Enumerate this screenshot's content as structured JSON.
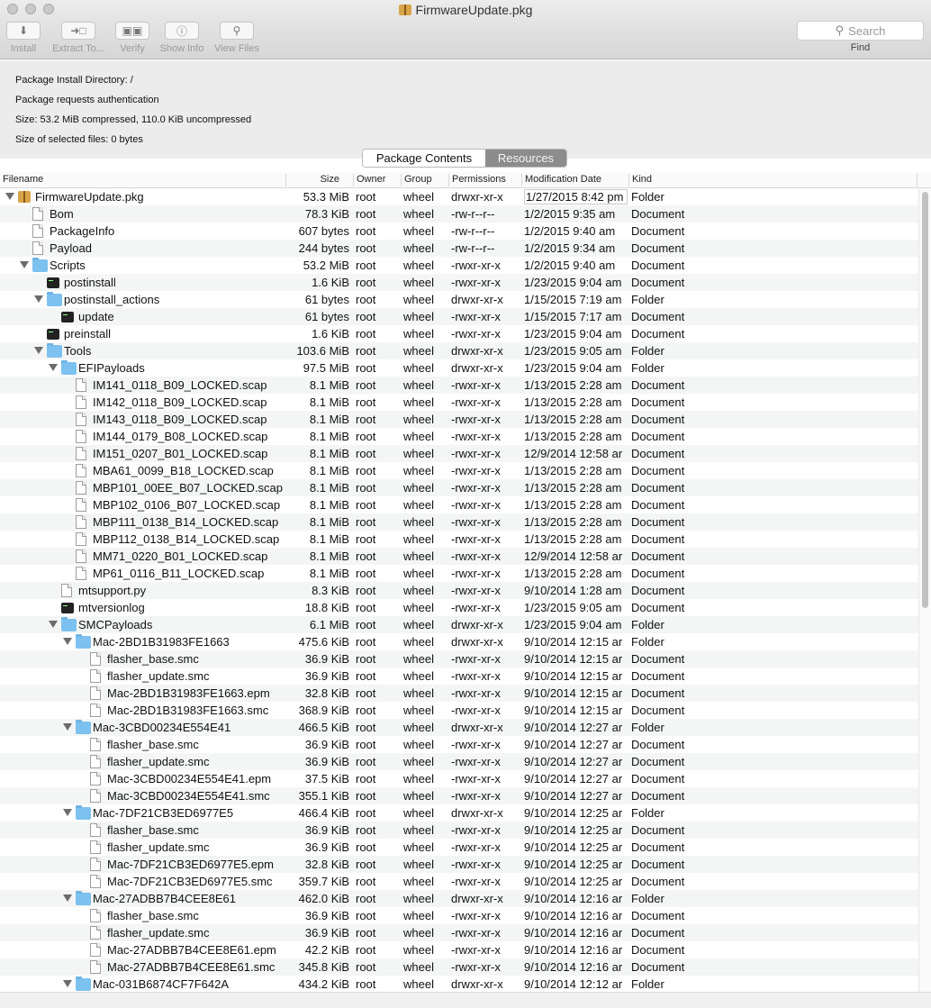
{
  "window": {
    "title": "FirmwareUpdate.pkg"
  },
  "toolbar": {
    "buttons": [
      {
        "label": "Install",
        "icon": "download-arrow-icon"
      },
      {
        "label": "Extract To...",
        "icon": "extract-folder-icon"
      },
      {
        "label": "Verify",
        "icon": "verify-documents-icon"
      },
      {
        "label": "Show Info",
        "icon": "info-icon"
      },
      {
        "label": "View Files",
        "icon": "magnifier-icon"
      }
    ],
    "search_placeholder": "Search",
    "find_label": "Find"
  },
  "info": {
    "install_dir": "Package Install Directory: /",
    "auth": "Package requests authentication",
    "size": "Size: 53.2 MiB compressed, 110.0 KiB uncompressed",
    "selected": "Size of selected files: 0 bytes"
  },
  "segmented": {
    "contents": "Package Contents",
    "resources": "Resources",
    "selected": "Package Contents"
  },
  "columns": [
    "Filename",
    "Size",
    "Owner",
    "Group",
    "Permissions",
    "Modification Date",
    "Kind"
  ],
  "rows": [
    {
      "d": 0,
      "t": "o",
      "i": "pkg",
      "n": "FirmwareUpdate.pkg",
      "s": "53.3 MiB",
      "o": "root",
      "g": "wheel",
      "p": "drwxr-xr-x",
      "m": "1/27/2015 8:42 pm",
      "k": "Folder"
    },
    {
      "d": 1,
      "t": "",
      "i": "doc",
      "n": "Bom",
      "s": "78.3 KiB",
      "o": "root",
      "g": "wheel",
      "p": "-rw-r--r--",
      "m": "1/2/2015 9:35 am",
      "k": "Document"
    },
    {
      "d": 1,
      "t": "",
      "i": "doc",
      "n": "PackageInfo",
      "s": "607 bytes",
      "o": "root",
      "g": "wheel",
      "p": "-rw-r--r--",
      "m": "1/2/2015 9:40 am",
      "k": "Document"
    },
    {
      "d": 1,
      "t": "",
      "i": "doc",
      "n": "Payload",
      "s": "244 bytes",
      "o": "root",
      "g": "wheel",
      "p": "-rw-r--r--",
      "m": "1/2/2015 9:34 am",
      "k": "Document"
    },
    {
      "d": 1,
      "t": "o",
      "i": "folder",
      "n": "Scripts",
      "s": "53.2 MiB",
      "o": "root",
      "g": "wheel",
      "p": "-rwxr-xr-x",
      "m": "1/2/2015 9:40 am",
      "k": "Document"
    },
    {
      "d": 2,
      "t": "",
      "i": "exec",
      "n": "postinstall",
      "s": "1.6 KiB",
      "o": "root",
      "g": "wheel",
      "p": "-rwxr-xr-x",
      "m": "1/23/2015 9:04 am",
      "k": "Document"
    },
    {
      "d": 2,
      "t": "o",
      "i": "folder",
      "n": "postinstall_actions",
      "s": "61 bytes",
      "o": "root",
      "g": "wheel",
      "p": "drwxr-xr-x",
      "m": "1/15/2015 7:19 am",
      "k": "Folder"
    },
    {
      "d": 3,
      "t": "",
      "i": "exec",
      "n": "update",
      "s": "61 bytes",
      "o": "root",
      "g": "wheel",
      "p": "-rwxr-xr-x",
      "m": "1/15/2015 7:17 am",
      "k": "Document"
    },
    {
      "d": 2,
      "t": "",
      "i": "exec",
      "n": "preinstall",
      "s": "1.6 KiB",
      "o": "root",
      "g": "wheel",
      "p": "-rwxr-xr-x",
      "m": "1/23/2015 9:04 am",
      "k": "Document"
    },
    {
      "d": 2,
      "t": "o",
      "i": "folder",
      "n": "Tools",
      "s": "103.6 MiB",
      "o": "root",
      "g": "wheel",
      "p": "drwxr-xr-x",
      "m": "1/23/2015 9:05 am",
      "k": "Folder"
    },
    {
      "d": 3,
      "t": "o",
      "i": "folder",
      "n": "EFIPayloads",
      "s": "97.5 MiB",
      "o": "root",
      "g": "wheel",
      "p": "drwxr-xr-x",
      "m": "1/23/2015 9:04 am",
      "k": "Folder"
    },
    {
      "d": 4,
      "t": "",
      "i": "doc",
      "n": "IM141_0118_B09_LOCKED.scap",
      "s": "8.1 MiB",
      "o": "root",
      "g": "wheel",
      "p": "-rwxr-xr-x",
      "m": "1/13/2015 2:28 am",
      "k": "Document"
    },
    {
      "d": 4,
      "t": "",
      "i": "doc",
      "n": "IM142_0118_B09_LOCKED.scap",
      "s": "8.1 MiB",
      "o": "root",
      "g": "wheel",
      "p": "-rwxr-xr-x",
      "m": "1/13/2015 2:28 am",
      "k": "Document"
    },
    {
      "d": 4,
      "t": "",
      "i": "doc",
      "n": "IM143_0118_B09_LOCKED.scap",
      "s": "8.1 MiB",
      "o": "root",
      "g": "wheel",
      "p": "-rwxr-xr-x",
      "m": "1/13/2015 2:28 am",
      "k": "Document"
    },
    {
      "d": 4,
      "t": "",
      "i": "doc",
      "n": "IM144_0179_B08_LOCKED.scap",
      "s": "8.1 MiB",
      "o": "root",
      "g": "wheel",
      "p": "-rwxr-xr-x",
      "m": "1/13/2015 2:28 am",
      "k": "Document"
    },
    {
      "d": 4,
      "t": "",
      "i": "doc",
      "n": "IM151_0207_B01_LOCKED.scap",
      "s": "8.1 MiB",
      "o": "root",
      "g": "wheel",
      "p": "-rwxr-xr-x",
      "m": "12/9/2014 12:58 ar",
      "k": "Document"
    },
    {
      "d": 4,
      "t": "",
      "i": "doc",
      "n": "MBA61_0099_B18_LOCKED.scap",
      "s": "8.1 MiB",
      "o": "root",
      "g": "wheel",
      "p": "-rwxr-xr-x",
      "m": "1/13/2015 2:28 am",
      "k": "Document"
    },
    {
      "d": 4,
      "t": "",
      "i": "doc",
      "n": "MBP101_00EE_B07_LOCKED.scap",
      "s": "8.1 MiB",
      "o": "root",
      "g": "wheel",
      "p": "-rwxr-xr-x",
      "m": "1/13/2015 2:28 am",
      "k": "Document"
    },
    {
      "d": 4,
      "t": "",
      "i": "doc",
      "n": "MBP102_0106_B07_LOCKED.scap",
      "s": "8.1 MiB",
      "o": "root",
      "g": "wheel",
      "p": "-rwxr-xr-x",
      "m": "1/13/2015 2:28 am",
      "k": "Document"
    },
    {
      "d": 4,
      "t": "",
      "i": "doc",
      "n": "MBP111_0138_B14_LOCKED.scap",
      "s": "8.1 MiB",
      "o": "root",
      "g": "wheel",
      "p": "-rwxr-xr-x",
      "m": "1/13/2015 2:28 am",
      "k": "Document"
    },
    {
      "d": 4,
      "t": "",
      "i": "doc",
      "n": "MBP112_0138_B14_LOCKED.scap",
      "s": "8.1 MiB",
      "o": "root",
      "g": "wheel",
      "p": "-rwxr-xr-x",
      "m": "1/13/2015 2:28 am",
      "k": "Document"
    },
    {
      "d": 4,
      "t": "",
      "i": "doc",
      "n": "MM71_0220_B01_LOCKED.scap",
      "s": "8.1 MiB",
      "o": "root",
      "g": "wheel",
      "p": "-rwxr-xr-x",
      "m": "12/9/2014 12:58 ar",
      "k": "Document"
    },
    {
      "d": 4,
      "t": "",
      "i": "doc",
      "n": "MP61_0116_B11_LOCKED.scap",
      "s": "8.1 MiB",
      "o": "root",
      "g": "wheel",
      "p": "-rwxr-xr-x",
      "m": "1/13/2015 2:28 am",
      "k": "Document"
    },
    {
      "d": 3,
      "t": "",
      "i": "doc",
      "n": "mtsupport.py",
      "s": "8.3 KiB",
      "o": "root",
      "g": "wheel",
      "p": "-rwxr-xr-x",
      "m": "9/10/2014 1:28 am",
      "k": "Document"
    },
    {
      "d": 3,
      "t": "",
      "i": "exec",
      "n": "mtversionlog",
      "s": "18.8 KiB",
      "o": "root",
      "g": "wheel",
      "p": "-rwxr-xr-x",
      "m": "1/23/2015 9:05 am",
      "k": "Document"
    },
    {
      "d": 3,
      "t": "o",
      "i": "folder",
      "n": "SMCPayloads",
      "s": "6.1 MiB",
      "o": "root",
      "g": "wheel",
      "p": "drwxr-xr-x",
      "m": "1/23/2015 9:04 am",
      "k": "Folder"
    },
    {
      "d": 4,
      "t": "o",
      "i": "folder",
      "n": "Mac-2BD1B31983FE1663",
      "s": "475.6 KiB",
      "o": "root",
      "g": "wheel",
      "p": "drwxr-xr-x",
      "m": "9/10/2014 12:15 ar",
      "k": "Folder"
    },
    {
      "d": 5,
      "t": "",
      "i": "doc",
      "n": "flasher_base.smc",
      "s": "36.9 KiB",
      "o": "root",
      "g": "wheel",
      "p": "-rwxr-xr-x",
      "m": "9/10/2014 12:15 ar",
      "k": "Document"
    },
    {
      "d": 5,
      "t": "",
      "i": "doc",
      "n": "flasher_update.smc",
      "s": "36.9 KiB",
      "o": "root",
      "g": "wheel",
      "p": "-rwxr-xr-x",
      "m": "9/10/2014 12:15 ar",
      "k": "Document"
    },
    {
      "d": 5,
      "t": "",
      "i": "doc",
      "n": "Mac-2BD1B31983FE1663.epm",
      "s": "32.8 KiB",
      "o": "root",
      "g": "wheel",
      "p": "-rwxr-xr-x",
      "m": "9/10/2014 12:15 ar",
      "k": "Document"
    },
    {
      "d": 5,
      "t": "",
      "i": "doc",
      "n": "Mac-2BD1B31983FE1663.smc",
      "s": "368.9 KiB",
      "o": "root",
      "g": "wheel",
      "p": "-rwxr-xr-x",
      "m": "9/10/2014 12:15 ar",
      "k": "Document"
    },
    {
      "d": 4,
      "t": "o",
      "i": "folder",
      "n": "Mac-3CBD00234E554E41",
      "s": "466.5 KiB",
      "o": "root",
      "g": "wheel",
      "p": "drwxr-xr-x",
      "m": "9/10/2014 12:27 ar",
      "k": "Folder"
    },
    {
      "d": 5,
      "t": "",
      "i": "doc",
      "n": "flasher_base.smc",
      "s": "36.9 KiB",
      "o": "root",
      "g": "wheel",
      "p": "-rwxr-xr-x",
      "m": "9/10/2014 12:27 ar",
      "k": "Document"
    },
    {
      "d": 5,
      "t": "",
      "i": "doc",
      "n": "flasher_update.smc",
      "s": "36.9 KiB",
      "o": "root",
      "g": "wheel",
      "p": "-rwxr-xr-x",
      "m": "9/10/2014 12:27 ar",
      "k": "Document"
    },
    {
      "d": 5,
      "t": "",
      "i": "doc",
      "n": "Mac-3CBD00234E554E41.epm",
      "s": "37.5 KiB",
      "o": "root",
      "g": "wheel",
      "p": "-rwxr-xr-x",
      "m": "9/10/2014 12:27 ar",
      "k": "Document"
    },
    {
      "d": 5,
      "t": "",
      "i": "doc",
      "n": "Mac-3CBD00234E554E41.smc",
      "s": "355.1 KiB",
      "o": "root",
      "g": "wheel",
      "p": "-rwxr-xr-x",
      "m": "9/10/2014 12:27 ar",
      "k": "Document"
    },
    {
      "d": 4,
      "t": "o",
      "i": "folder",
      "n": "Mac-7DF21CB3ED6977E5",
      "s": "466.4 KiB",
      "o": "root",
      "g": "wheel",
      "p": "drwxr-xr-x",
      "m": "9/10/2014 12:25 ar",
      "k": "Folder"
    },
    {
      "d": 5,
      "t": "",
      "i": "doc",
      "n": "flasher_base.smc",
      "s": "36.9 KiB",
      "o": "root",
      "g": "wheel",
      "p": "-rwxr-xr-x",
      "m": "9/10/2014 12:25 ar",
      "k": "Document"
    },
    {
      "d": 5,
      "t": "",
      "i": "doc",
      "n": "flasher_update.smc",
      "s": "36.9 KiB",
      "o": "root",
      "g": "wheel",
      "p": "-rwxr-xr-x",
      "m": "9/10/2014 12:25 ar",
      "k": "Document"
    },
    {
      "d": 5,
      "t": "",
      "i": "doc",
      "n": "Mac-7DF21CB3ED6977E5.epm",
      "s": "32.8 KiB",
      "o": "root",
      "g": "wheel",
      "p": "-rwxr-xr-x",
      "m": "9/10/2014 12:25 ar",
      "k": "Document"
    },
    {
      "d": 5,
      "t": "",
      "i": "doc",
      "n": "Mac-7DF21CB3ED6977E5.smc",
      "s": "359.7 KiB",
      "o": "root",
      "g": "wheel",
      "p": "-rwxr-xr-x",
      "m": "9/10/2014 12:25 ar",
      "k": "Document"
    },
    {
      "d": 4,
      "t": "o",
      "i": "folder",
      "n": "Mac-27ADBB7B4CEE8E61",
      "s": "462.0 KiB",
      "o": "root",
      "g": "wheel",
      "p": "drwxr-xr-x",
      "m": "9/10/2014 12:16 ar",
      "k": "Folder"
    },
    {
      "d": 5,
      "t": "",
      "i": "doc",
      "n": "flasher_base.smc",
      "s": "36.9 KiB",
      "o": "root",
      "g": "wheel",
      "p": "-rwxr-xr-x",
      "m": "9/10/2014 12:16 ar",
      "k": "Document"
    },
    {
      "d": 5,
      "t": "",
      "i": "doc",
      "n": "flasher_update.smc",
      "s": "36.9 KiB",
      "o": "root",
      "g": "wheel",
      "p": "-rwxr-xr-x",
      "m": "9/10/2014 12:16 ar",
      "k": "Document"
    },
    {
      "d": 5,
      "t": "",
      "i": "doc",
      "n": "Mac-27ADBB7B4CEE8E61.epm",
      "s": "42.2 KiB",
      "o": "root",
      "g": "wheel",
      "p": "-rwxr-xr-x",
      "m": "9/10/2014 12:16 ar",
      "k": "Document"
    },
    {
      "d": 5,
      "t": "",
      "i": "doc",
      "n": "Mac-27ADBB7B4CEE8E61.smc",
      "s": "345.8 KiB",
      "o": "root",
      "g": "wheel",
      "p": "-rwxr-xr-x",
      "m": "9/10/2014 12:16 ar",
      "k": "Document"
    },
    {
      "d": 4,
      "t": "o",
      "i": "folder",
      "n": "Mac-031B6874CF7F642A",
      "s": "434.2 KiB",
      "o": "root",
      "g": "wheel",
      "p": "drwxr-xr-x",
      "m": "9/10/2014 12:12 ar",
      "k": "Folder"
    }
  ]
}
